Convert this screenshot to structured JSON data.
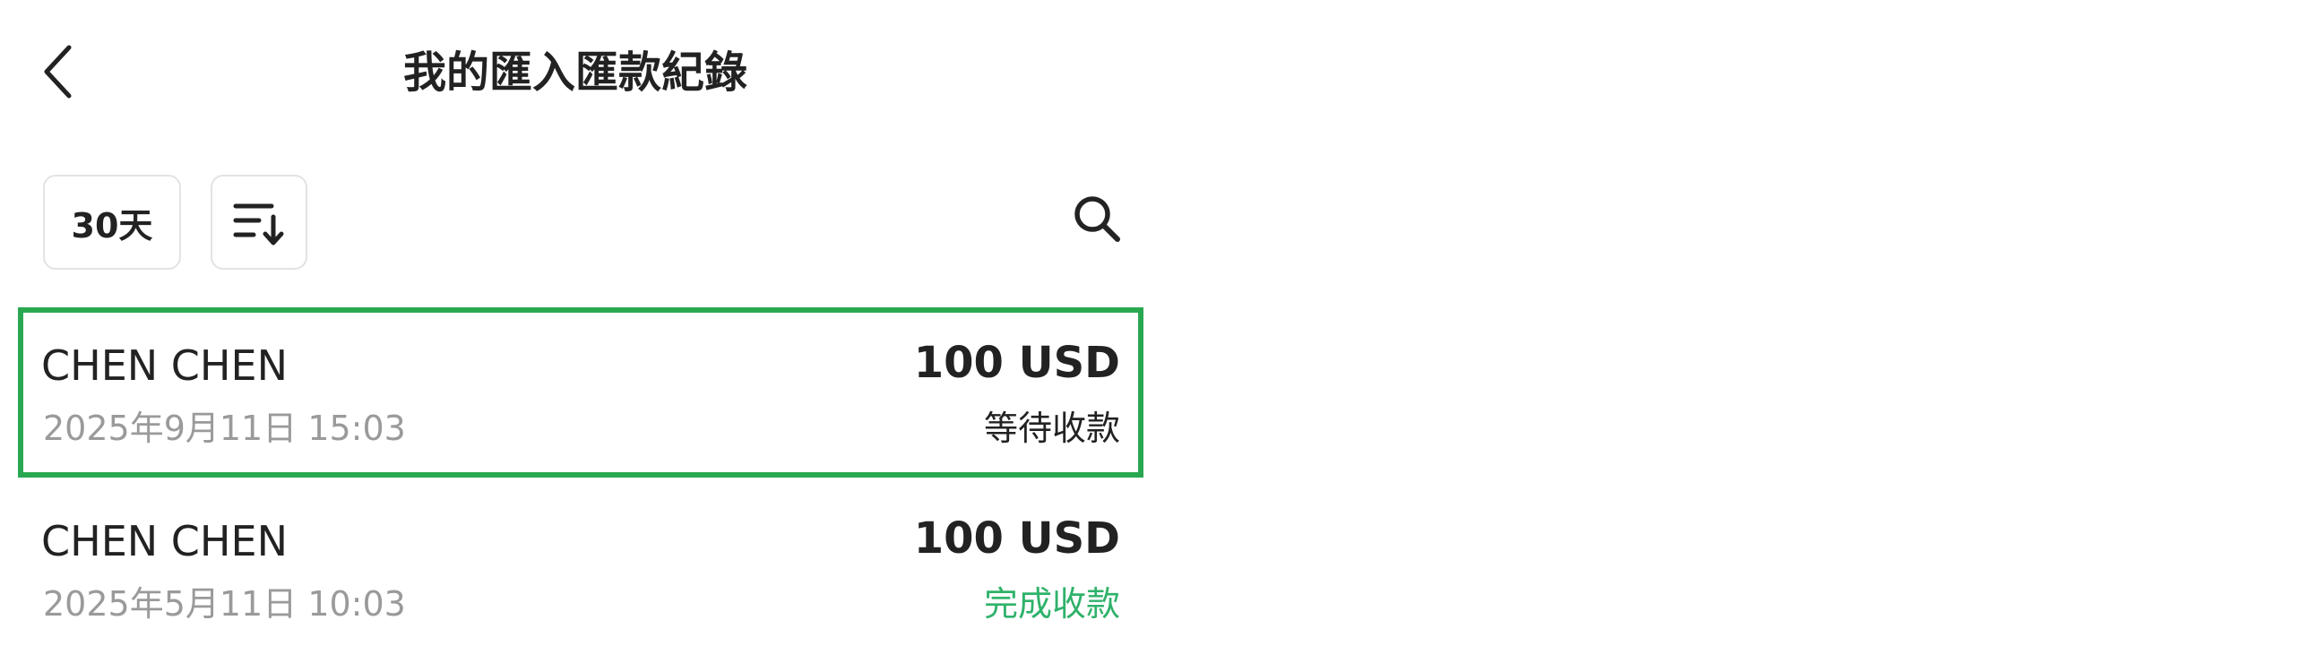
{
  "header": {
    "title": "我的匯入匯款紀錄",
    "back_icon": "chevron-left-icon"
  },
  "toolbar": {
    "period_filter_label": "30天",
    "sort_icon": "sort-descending-icon",
    "search_icon": "search-icon"
  },
  "records": [
    {
      "name": "CHEN CHEN",
      "datetime": "2025年9月11日 15:03",
      "amount": "100 USD",
      "status": "等待收款",
      "status_color": "#222222",
      "highlighted": true
    },
    {
      "name": "CHEN CHEN",
      "datetime": "2025年5月11日 10:03",
      "amount": "100 USD",
      "status": "完成收款",
      "status_color": "#2fb26a",
      "highlighted": false
    }
  ],
  "colors": {
    "highlight_border": "#2aa851",
    "date_text": "#9a9a9a",
    "button_border": "#e3e3e3"
  }
}
